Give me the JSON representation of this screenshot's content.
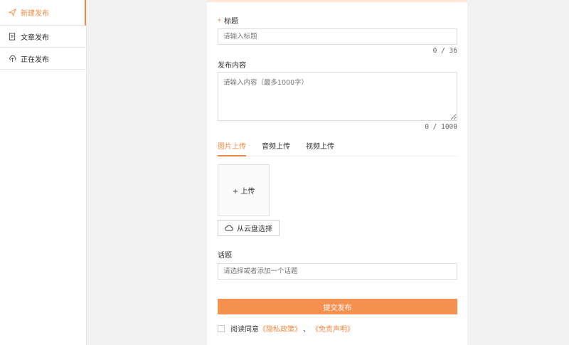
{
  "sidebar": {
    "items": [
      {
        "label": "新建发布",
        "icon": "send-icon",
        "active": true
      },
      {
        "label": "文章发布",
        "icon": "document-icon",
        "active": false
      },
      {
        "label": "正在发布",
        "icon": "upload-icon",
        "active": false
      }
    ]
  },
  "form": {
    "title_label": "标题",
    "title_required_mark": "*",
    "title_placeholder": "请输入标题",
    "title_counter": "0 / 36",
    "content_label": "发布内容",
    "content_placeholder": "请输入内容（最多1000字）",
    "content_counter": "0 / 1000",
    "tabs": [
      {
        "label": "图片上传",
        "active": true
      },
      {
        "label": "音频上传",
        "active": false
      },
      {
        "label": "视频上传",
        "active": false
      }
    ],
    "upload_label": "+ 上传",
    "cloud_button_label": "从云盘选择",
    "topic_label": "话题",
    "topic_placeholder": "请选择或者添加一个话题",
    "submit_label": "提交发布",
    "agree_text": "阅读同意",
    "privacy_link": "《隐私政策》",
    "separator": "、",
    "disclaimer_link": "《免责声明》"
  },
  "colors": {
    "accent": "#f08b45",
    "submit_bg": "#f5904e",
    "page_bg": "#f2f2f2"
  }
}
